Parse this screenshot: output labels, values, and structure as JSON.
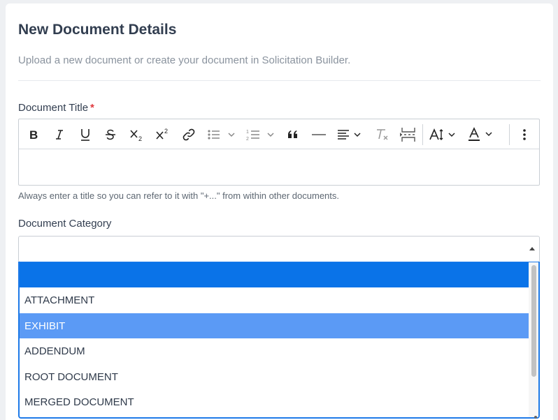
{
  "form": {
    "title": "New Document Details",
    "subtitle": "Upload a new document or create your document in Solicitation Builder.",
    "doc_title_label": "Document Title",
    "required_mark": "*",
    "doc_title_value": "",
    "doc_title_helper": "Always enter a title so you can refer to it with \"+...\" from within other documents.",
    "category_label": "Document Category",
    "category_selected": ""
  },
  "toolbar": {
    "items": [
      {
        "name": "bold-icon"
      },
      {
        "name": "italic-icon"
      },
      {
        "name": "underline-icon"
      },
      {
        "name": "strikethrough-icon"
      },
      {
        "name": "subscript-icon"
      },
      {
        "name": "superscript-icon"
      },
      {
        "name": "link-icon"
      },
      {
        "name": "bulleted-list-icon"
      },
      {
        "name": "numbered-list-icon"
      },
      {
        "name": "blockquote-icon"
      },
      {
        "name": "horizontal-line-icon"
      },
      {
        "name": "align-icon"
      },
      {
        "name": "remove-format-icon"
      },
      {
        "name": "page-break-icon"
      },
      {
        "name": "font-size-icon"
      },
      {
        "name": "font-color-icon"
      },
      {
        "name": "more-options-icon"
      }
    ]
  },
  "dropdown": {
    "options": [
      "",
      "ATTACHMENT",
      "EXHIBIT",
      "ADDENDUM",
      "ROOT DOCUMENT",
      "MERGED DOCUMENT"
    ],
    "active_index": 0,
    "hover_index": 2
  },
  "colors": {
    "accent": "#0a73e8",
    "hover": "#5b9af5",
    "required": "#e0393e"
  }
}
